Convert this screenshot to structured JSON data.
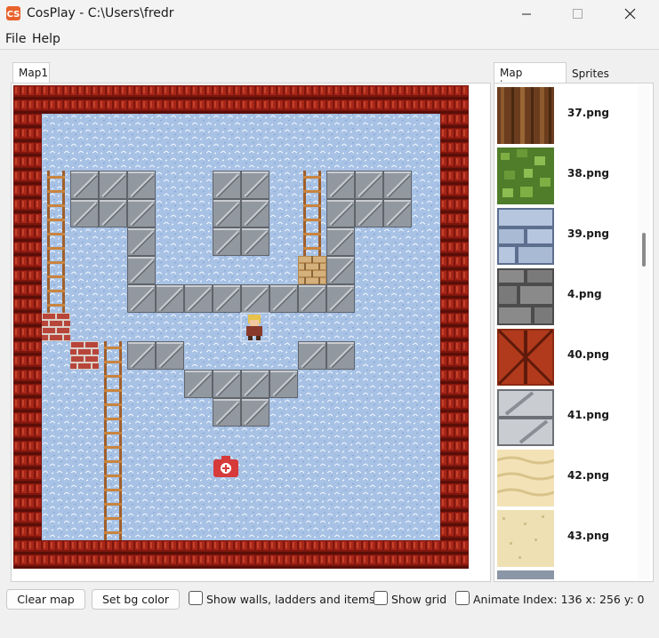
{
  "window": {
    "title": "CosPlay - C:\\Users\\fredr"
  },
  "menu": [
    "File",
    "Help"
  ],
  "map_tab": {
    "label": "Map1"
  },
  "side_tabs": [
    {
      "label": "Map images",
      "active": true
    },
    {
      "label": "Sprites",
      "active": false
    }
  ],
  "image_list": [
    {
      "name": "37.png",
      "icon": "wood-tile"
    },
    {
      "name": "38.png",
      "icon": "grass-tile"
    },
    {
      "name": "39.png",
      "icon": "blue-stone-tile"
    },
    {
      "name": "4.png",
      "icon": "gray-stone-tile"
    },
    {
      "name": "40.png",
      "icon": "red-brick-tile"
    },
    {
      "name": "41.png",
      "icon": "metal-plate-tile"
    },
    {
      "name": "42.png",
      "icon": "sand-tile"
    },
    {
      "name": "43.png",
      "icon": "light-sand-tile"
    }
  ],
  "toolbar": {
    "clear_map": "Clear map",
    "set_bg_color": "Set bg color",
    "show_walls": "Show walls, ladders and items",
    "show_grid": "Show grid",
    "animate": "Animate",
    "status": "Index: 136 x: 256 y: 0"
  },
  "colors": {
    "wall": "#8b1a10",
    "water": "#a9c3e6",
    "block": "#8f949b",
    "accent": "#d63a3a"
  }
}
